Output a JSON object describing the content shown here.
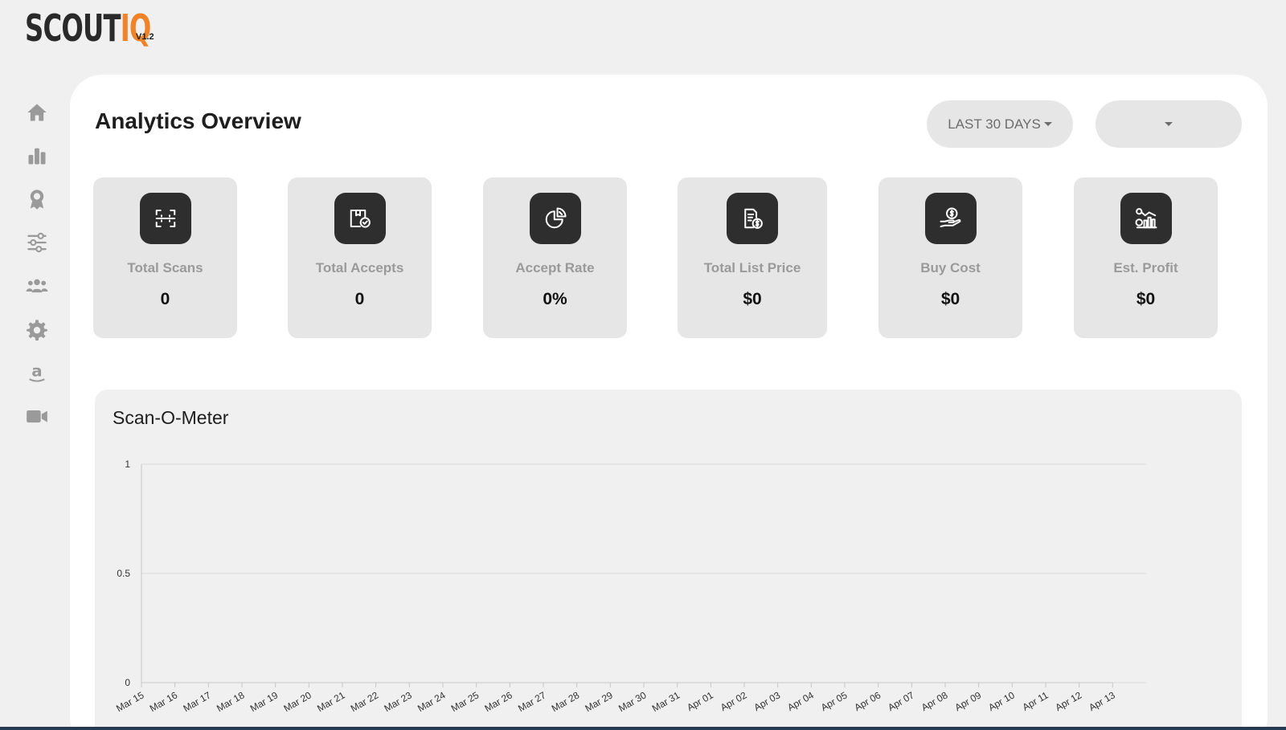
{
  "app": {
    "logo_scout": "SCOUT",
    "logo_iq": "IQ",
    "version": "V1.2"
  },
  "sidebar": {
    "items": [
      {
        "icon": "home-icon"
      },
      {
        "icon": "bar-chart-icon"
      },
      {
        "icon": "award-icon"
      },
      {
        "icon": "sliders-icon"
      },
      {
        "icon": "users-icon"
      },
      {
        "icon": "gear-icon"
      },
      {
        "icon": "amazon-icon"
      },
      {
        "icon": "video-icon"
      }
    ]
  },
  "header": {
    "title": "Analytics Overview",
    "range_label": "LAST 30 DAYS",
    "account_value": ""
  },
  "stats": [
    {
      "label": "Total Scans",
      "value": "0",
      "icon": "scan-icon"
    },
    {
      "label": "Total Accepts",
      "value": "0",
      "icon": "box-check-icon"
    },
    {
      "label": "Accept Rate",
      "value": "0%",
      "icon": "pie-chart-icon"
    },
    {
      "label": "Total List Price",
      "value": "$0",
      "icon": "document-dollar-icon"
    },
    {
      "label": "Buy Cost",
      "value": "$0",
      "icon": "hand-dollar-icon"
    },
    {
      "label": "Est. Profit",
      "value": "$0",
      "icon": "profit-chart-icon"
    }
  ],
  "chart": {
    "title": "Scan-O-Meter"
  },
  "chart_data": {
    "type": "line",
    "title": "Scan-O-Meter",
    "x": [
      "Mar 15",
      "Mar 16",
      "Mar 17",
      "Mar 18",
      "Mar 19",
      "Mar 20",
      "Mar 21",
      "Mar 22",
      "Mar 23",
      "Mar 24",
      "Mar 25",
      "Mar 26",
      "Mar 27",
      "Mar 28",
      "Mar 29",
      "Mar 30",
      "Mar 31",
      "Apr 01",
      "Apr 02",
      "Apr 03",
      "Apr 04",
      "Apr 05",
      "Apr 06",
      "Apr 07",
      "Apr 08",
      "Apr 09",
      "Apr 10",
      "Apr 11",
      "Apr 12",
      "Apr 13"
    ],
    "y_ticks": [
      "0",
      "0.5",
      "1"
    ],
    "ylim": [
      0,
      1
    ],
    "grid": true,
    "series": [
      {
        "values": [
          0,
          0,
          0,
          0,
          0,
          0,
          0,
          0,
          0,
          0,
          0,
          0,
          0,
          0,
          0,
          0,
          0,
          0,
          0,
          0,
          0,
          0,
          0,
          0,
          0,
          0,
          0,
          0,
          0,
          0
        ]
      }
    ],
    "colors": {
      "grid": "#dcdcdc",
      "axis": "#c8c8c8",
      "tick_text": "#333333"
    }
  }
}
